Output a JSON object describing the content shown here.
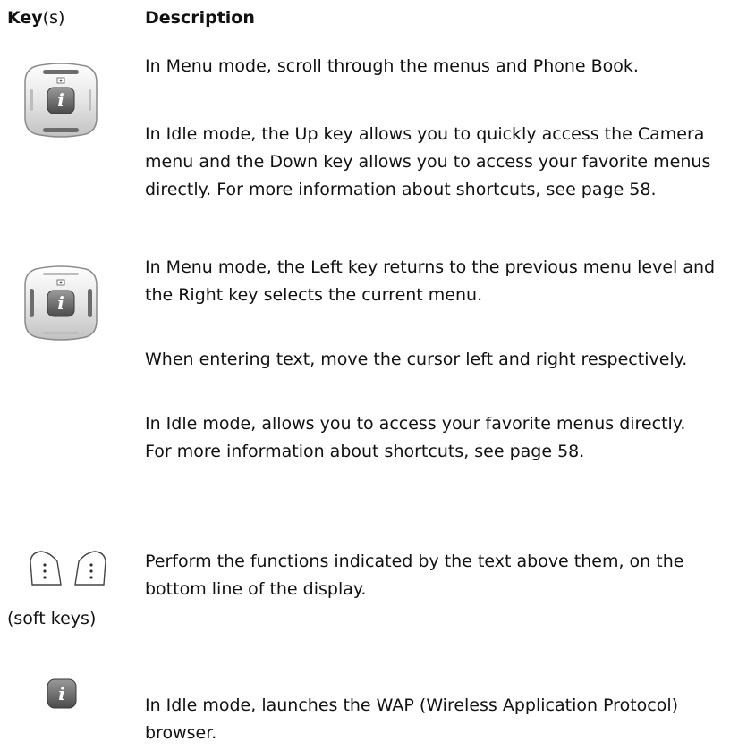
{
  "header": {
    "key_bold": "Key",
    "key_suffix": "(s)",
    "description": "Description"
  },
  "rows": [
    {
      "icon": "navigation-key-up-down-icon",
      "paragraphs": [
        "In Menu mode, scroll through the menus and Phone Book.",
        "In Idle mode, the Up key allows you to quickly access the Camera menu and the Down key allows you to access your favorite menus directly. For more information about shortcuts, see page 58."
      ]
    },
    {
      "icon": "navigation-key-left-right-icon",
      "paragraphs": [
        "In Menu mode, the Left key returns to the previous menu level and the Right key selects the current menu.",
        "When entering text, move the cursor left and right respectively.",
        "In Idle mode, allows you to access your favorite menus directly. For more information about shortcuts, see page 58."
      ]
    },
    {
      "icon": "soft-keys-icon",
      "caption": "(soft keys)",
      "paragraphs": [
        "Perform the functions indicated by the text above them, on the bottom line of the display."
      ]
    },
    {
      "icon": "wap-key-icon",
      "icon_letter": "i",
      "paragraphs": [
        "In Idle mode, launches the WAP (Wireless Application Protocol) browser."
      ]
    }
  ]
}
